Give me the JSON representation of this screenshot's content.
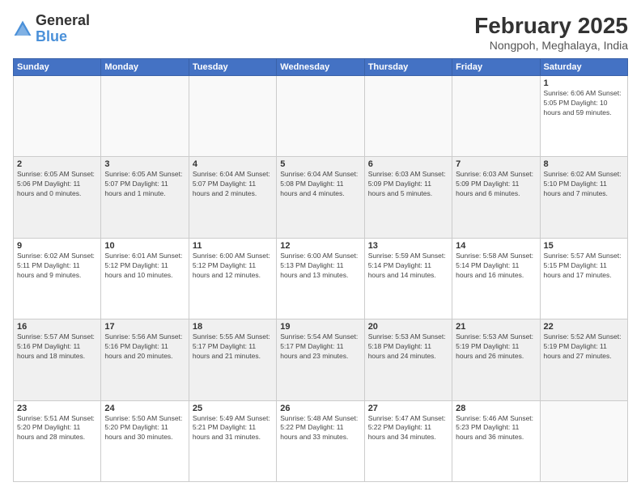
{
  "header": {
    "logo_general": "General",
    "logo_blue": "Blue",
    "month_title": "February 2025",
    "location": "Nongpoh, Meghalaya, India"
  },
  "weekdays": [
    "Sunday",
    "Monday",
    "Tuesday",
    "Wednesday",
    "Thursday",
    "Friday",
    "Saturday"
  ],
  "weeks": [
    [
      {
        "day": "",
        "info": ""
      },
      {
        "day": "",
        "info": ""
      },
      {
        "day": "",
        "info": ""
      },
      {
        "day": "",
        "info": ""
      },
      {
        "day": "",
        "info": ""
      },
      {
        "day": "",
        "info": ""
      },
      {
        "day": "1",
        "info": "Sunrise: 6:06 AM\nSunset: 5:05 PM\nDaylight: 10 hours and 59 minutes."
      }
    ],
    [
      {
        "day": "2",
        "info": "Sunrise: 6:05 AM\nSunset: 5:06 PM\nDaylight: 11 hours and 0 minutes."
      },
      {
        "day": "3",
        "info": "Sunrise: 6:05 AM\nSunset: 5:07 PM\nDaylight: 11 hours and 1 minute."
      },
      {
        "day": "4",
        "info": "Sunrise: 6:04 AM\nSunset: 5:07 PM\nDaylight: 11 hours and 2 minutes."
      },
      {
        "day": "5",
        "info": "Sunrise: 6:04 AM\nSunset: 5:08 PM\nDaylight: 11 hours and 4 minutes."
      },
      {
        "day": "6",
        "info": "Sunrise: 6:03 AM\nSunset: 5:09 PM\nDaylight: 11 hours and 5 minutes."
      },
      {
        "day": "7",
        "info": "Sunrise: 6:03 AM\nSunset: 5:09 PM\nDaylight: 11 hours and 6 minutes."
      },
      {
        "day": "8",
        "info": "Sunrise: 6:02 AM\nSunset: 5:10 PM\nDaylight: 11 hours and 7 minutes."
      }
    ],
    [
      {
        "day": "9",
        "info": "Sunrise: 6:02 AM\nSunset: 5:11 PM\nDaylight: 11 hours and 9 minutes."
      },
      {
        "day": "10",
        "info": "Sunrise: 6:01 AM\nSunset: 5:12 PM\nDaylight: 11 hours and 10 minutes."
      },
      {
        "day": "11",
        "info": "Sunrise: 6:00 AM\nSunset: 5:12 PM\nDaylight: 11 hours and 12 minutes."
      },
      {
        "day": "12",
        "info": "Sunrise: 6:00 AM\nSunset: 5:13 PM\nDaylight: 11 hours and 13 minutes."
      },
      {
        "day": "13",
        "info": "Sunrise: 5:59 AM\nSunset: 5:14 PM\nDaylight: 11 hours and 14 minutes."
      },
      {
        "day": "14",
        "info": "Sunrise: 5:58 AM\nSunset: 5:14 PM\nDaylight: 11 hours and 16 minutes."
      },
      {
        "day": "15",
        "info": "Sunrise: 5:57 AM\nSunset: 5:15 PM\nDaylight: 11 hours and 17 minutes."
      }
    ],
    [
      {
        "day": "16",
        "info": "Sunrise: 5:57 AM\nSunset: 5:16 PM\nDaylight: 11 hours and 18 minutes."
      },
      {
        "day": "17",
        "info": "Sunrise: 5:56 AM\nSunset: 5:16 PM\nDaylight: 11 hours and 20 minutes."
      },
      {
        "day": "18",
        "info": "Sunrise: 5:55 AM\nSunset: 5:17 PM\nDaylight: 11 hours and 21 minutes."
      },
      {
        "day": "19",
        "info": "Sunrise: 5:54 AM\nSunset: 5:17 PM\nDaylight: 11 hours and 23 minutes."
      },
      {
        "day": "20",
        "info": "Sunrise: 5:53 AM\nSunset: 5:18 PM\nDaylight: 11 hours and 24 minutes."
      },
      {
        "day": "21",
        "info": "Sunrise: 5:53 AM\nSunset: 5:19 PM\nDaylight: 11 hours and 26 minutes."
      },
      {
        "day": "22",
        "info": "Sunrise: 5:52 AM\nSunset: 5:19 PM\nDaylight: 11 hours and 27 minutes."
      }
    ],
    [
      {
        "day": "23",
        "info": "Sunrise: 5:51 AM\nSunset: 5:20 PM\nDaylight: 11 hours and 28 minutes."
      },
      {
        "day": "24",
        "info": "Sunrise: 5:50 AM\nSunset: 5:20 PM\nDaylight: 11 hours and 30 minutes."
      },
      {
        "day": "25",
        "info": "Sunrise: 5:49 AM\nSunset: 5:21 PM\nDaylight: 11 hours and 31 minutes."
      },
      {
        "day": "26",
        "info": "Sunrise: 5:48 AM\nSunset: 5:22 PM\nDaylight: 11 hours and 33 minutes."
      },
      {
        "day": "27",
        "info": "Sunrise: 5:47 AM\nSunset: 5:22 PM\nDaylight: 11 hours and 34 minutes."
      },
      {
        "day": "28",
        "info": "Sunrise: 5:46 AM\nSunset: 5:23 PM\nDaylight: 11 hours and 36 minutes."
      },
      {
        "day": "",
        "info": ""
      }
    ]
  ]
}
